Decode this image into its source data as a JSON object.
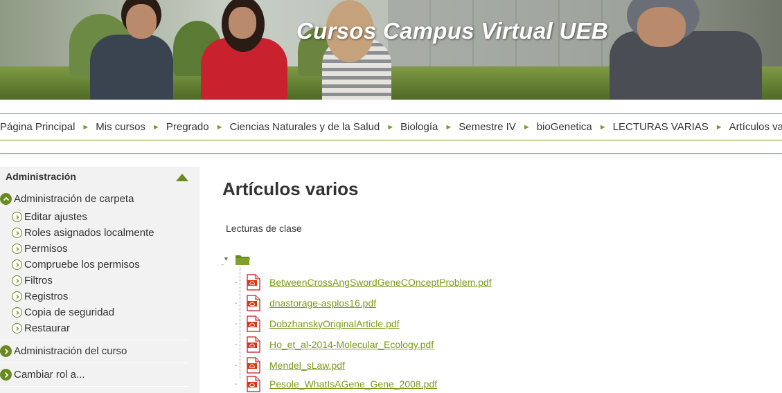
{
  "banner": {
    "title": "Cursos Campus Virtual UEB"
  },
  "breadcrumb": {
    "items": [
      "Página Principal",
      "Mis cursos",
      "Pregrado",
      "Ciencias Naturales y de la Salud",
      "Biología",
      "Semestre IV",
      "bioGenetica",
      "LECTURAS VARIAS",
      "Artículos varios"
    ],
    "separator": "►"
  },
  "admin_block": {
    "title": "Administración",
    "folder_admin": {
      "label": "Administración de carpeta",
      "items": [
        "Editar ajustes",
        "Roles asignados localmente",
        "Permisos",
        "Compruebe los permisos",
        "Filtros",
        "Registros",
        "Copia de seguridad",
        "Restaurar"
      ]
    },
    "course_admin": {
      "label": "Administración del curso"
    },
    "switch_role": {
      "label": "Cambiar rol a..."
    }
  },
  "main": {
    "title": "Artículos varios",
    "intro": "Lecturas de clase",
    "files": [
      "BetweenCrossAngSwordGeneCOnceptProblem.pdf",
      "dnastorage-asplos16.pdf",
      "DobzhanskyOriginalArticle.pdf",
      "Ho_et_al-2014-Molecular_Ecology.pdf",
      "Mendel_sLaw.pdf",
      "Pesole_WhatIsAGene_Gene_2008.pdf"
    ]
  },
  "colors": {
    "accent": "#6a8a1f",
    "link": "#7a9a1a",
    "block_bg": "#f2f2f2"
  },
  "icons": {
    "folder": "folder-icon",
    "file": "pdf-icon",
    "expand": "chevron-right-icon",
    "collapse": "chevron-up-icon"
  }
}
